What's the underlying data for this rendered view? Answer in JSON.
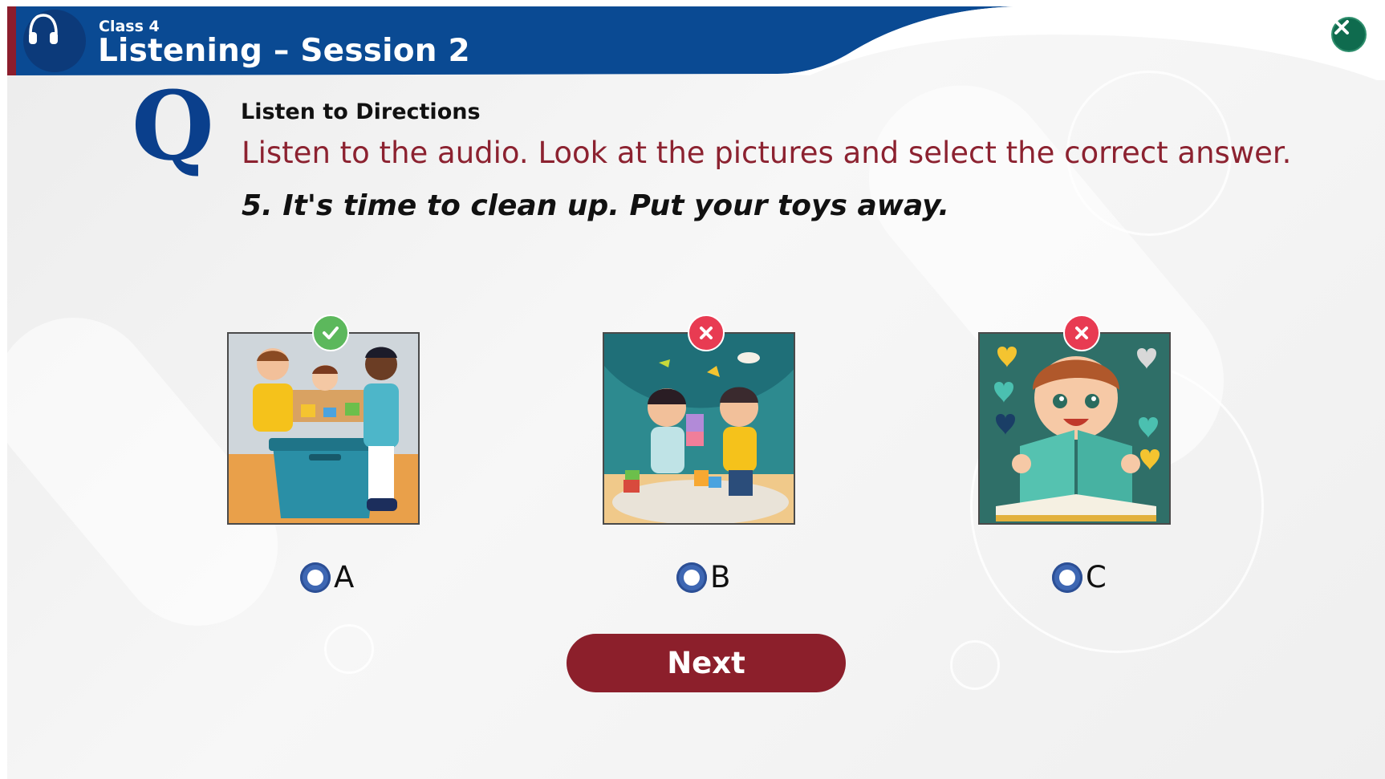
{
  "header": {
    "class_label": "Class 4",
    "session_title": "Listening – Session 2",
    "icon": "headphones-icon",
    "close_icon": "close-icon",
    "primary_color": "#0a4a93",
    "accent_color": "#8c1d2c"
  },
  "question": {
    "glyph": "Q",
    "directions_label": "Listen to Directions",
    "instruction": "Listen to the audio. Look at the pictures and select the correct answer.",
    "prompt": "5. It's time to clean up. Put your toys away."
  },
  "options": [
    {
      "label": "A",
      "image": "children-putting-toys-in-box",
      "status": "correct",
      "status_icon": "check-icon"
    },
    {
      "label": "B",
      "image": "children-playing-with-blocks",
      "status": "wrong",
      "status_icon": "x-icon"
    },
    {
      "label": "C",
      "image": "child-reading-book",
      "status": "wrong",
      "status_icon": "x-icon"
    }
  ],
  "colors": {
    "correct": "#5cb85c",
    "wrong": "#e83b52",
    "radio": "#3e67b3",
    "next_button": "#8c1f2b"
  },
  "next_button": {
    "label": "Next"
  }
}
